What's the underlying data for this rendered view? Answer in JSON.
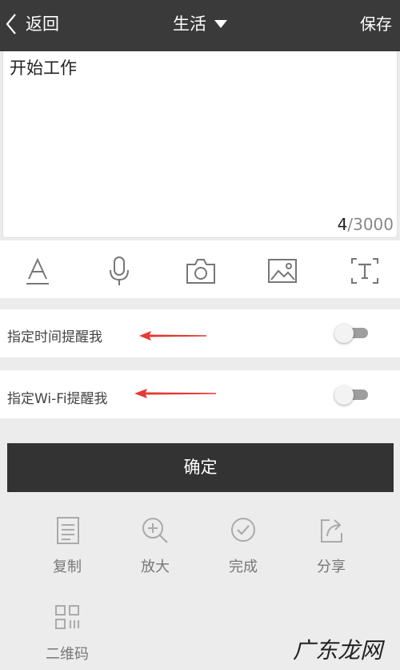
{
  "header": {
    "back_label": "返回",
    "category": "生活",
    "save_label": "保存",
    "background": "#3a3a3a"
  },
  "note": {
    "text": "开始工作",
    "count_current": "4",
    "count_separator": "/",
    "count_max": "3000"
  },
  "toolbar": {
    "icons": [
      "text-format-icon",
      "microphone-icon",
      "camera-icon",
      "image-icon",
      "text-recognition-icon"
    ]
  },
  "reminders": [
    {
      "label": "指定时间提醒我",
      "enabled": false
    },
    {
      "label": "指定Wi-Fi提醒我",
      "enabled": false
    }
  ],
  "annotation_color": "#e53935",
  "confirm_label": "确定",
  "actions": [
    {
      "label": "复制",
      "icon": "copy-icon"
    },
    {
      "label": "放大",
      "icon": "zoom-in-icon"
    },
    {
      "label": "完成",
      "icon": "check-circle-icon"
    },
    {
      "label": "分享",
      "icon": "share-icon"
    },
    {
      "label": "二维码",
      "icon": "qr-code-icon"
    }
  ],
  "watermark": "广东龙网"
}
